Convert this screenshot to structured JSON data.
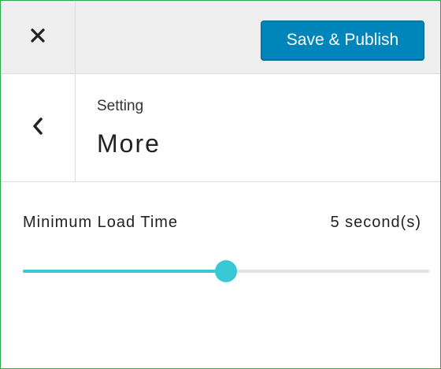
{
  "header": {
    "close_icon": "close-icon",
    "publish_label": "Save & Publish",
    "publish_color": "#0085ba"
  },
  "section": {
    "back_icon": "chevron-left-icon",
    "breadcrumb": "Setting",
    "title": "More"
  },
  "control": {
    "label": "Minimum Load Time",
    "value_text": "5 second(s)",
    "slider_fraction": 0.5,
    "accent_color": "#39c8d6"
  }
}
